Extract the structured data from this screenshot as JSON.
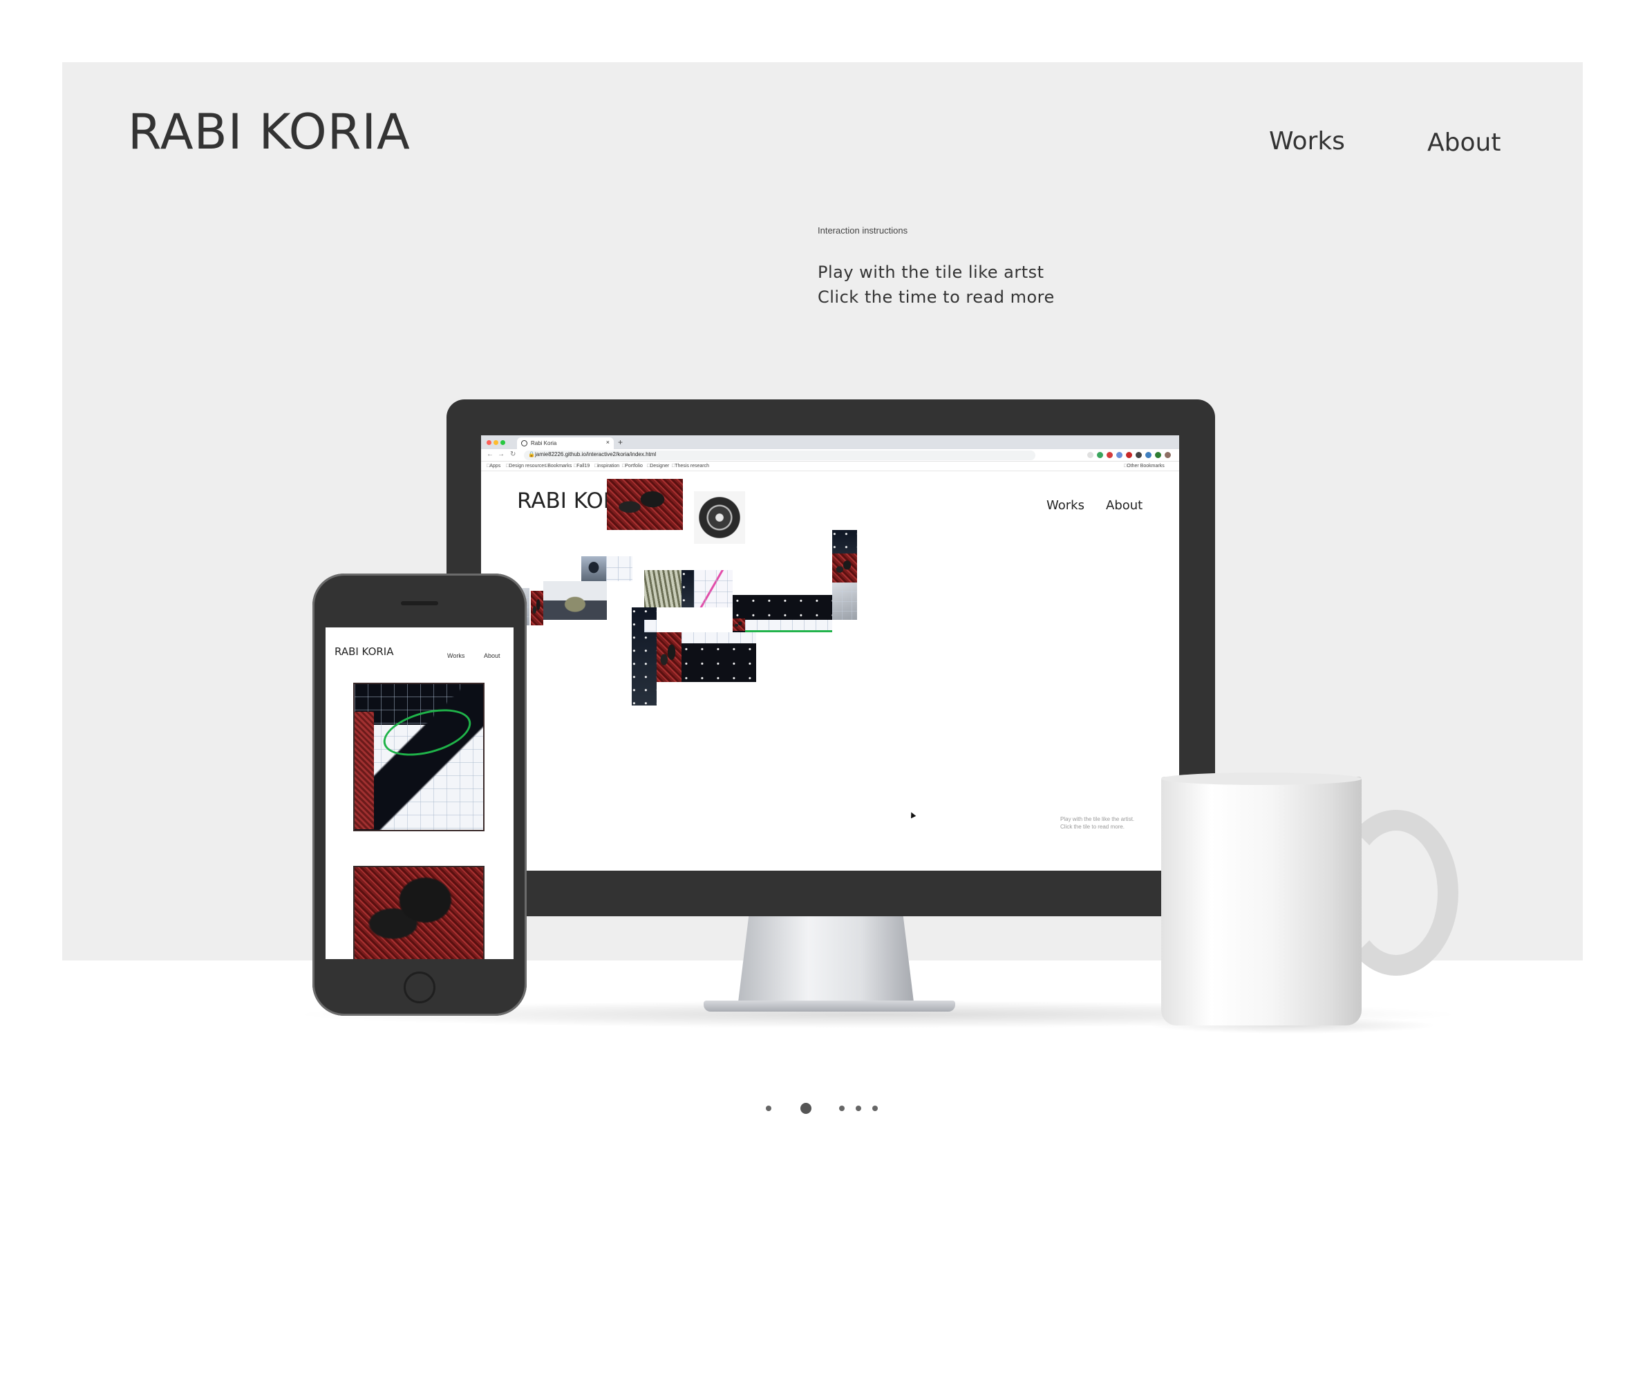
{
  "site": {
    "brand": "RABI KORIA",
    "nav": {
      "works": "Works",
      "about": "About"
    }
  },
  "instructions": {
    "title": "Interaction instructions",
    "line1": "Play with the tile like artst",
    "line2": "Click the time to read more"
  },
  "browser": {
    "tab_title": "Rabi Koria",
    "tab_close": "×",
    "new_tab": "+",
    "back_icon": "←",
    "forward_icon": "→",
    "reload_icon": "↻",
    "url": "jamie82226.github.io/interactive2/koria/index.html",
    "bookmarks": [
      "Apps",
      "Design resources",
      "Bookmarks",
      "Fall19",
      "inspiration",
      "Portfolio",
      "Designer",
      "Thesis research"
    ],
    "other_bookmarks": "Other Bookmarks",
    "extension_colors": [
      "#e0e0e0",
      "#3aa55d",
      "#d43c3c",
      "#6a8fd8",
      "#c62828",
      "#444444",
      "#3f7fbf",
      "#2e7d32",
      "#8d6e63"
    ]
  },
  "desktop_page": {
    "brand": "RABI KORIA",
    "nav_works": "Works",
    "nav_about": "About",
    "instr_line1": "Play with the tile like the artist.",
    "instr_line2": "Click the tile to read more."
  },
  "mobile_page": {
    "brand": "RABI KORIA",
    "nav_works": "Works",
    "nav_about": "About"
  },
  "carousel": {
    "count": 5,
    "active_index": 1
  },
  "colors": {
    "panel": "#eeeeee",
    "device": "#333333",
    "text": "#333333",
    "accent_green": "#22b34c",
    "accent_pink": "#e24ca9",
    "accent_red": "#8b2323"
  }
}
